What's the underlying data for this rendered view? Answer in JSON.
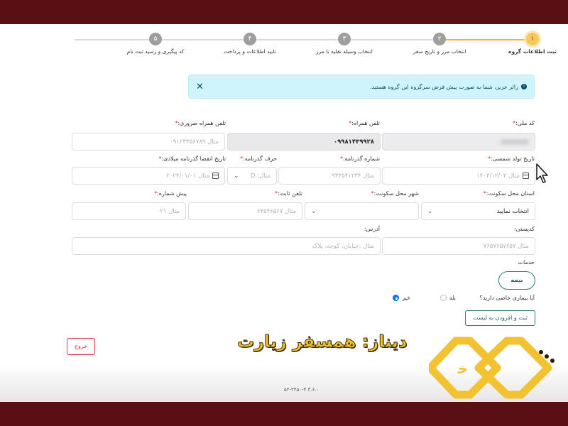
{
  "steps": [
    {
      "num": "۱",
      "label": "ثبت اطلاعات گروه",
      "active": true
    },
    {
      "num": "۲",
      "label": "انتخاب مرز و تاریخ سفر"
    },
    {
      "num": "۳",
      "label": "انتخاب وسیله نقلیه تا مرز"
    },
    {
      "num": "۴",
      "label": "تایید اطلاعات و پرداخت"
    },
    {
      "num": "۵",
      "label": "کد پیگیری و رسید ثبت نام"
    }
  ],
  "alert": {
    "text": "زائر عزیز، شما به صورت پیش فرض سرگروه این گروه هستید.",
    "info": "i",
    "close": "✕"
  },
  "form": {
    "national_code": {
      "label": "کد ملی:",
      "req": "*"
    },
    "mobile": {
      "label": "تلفن همراه:",
      "req": "*",
      "value": "۰۹۹۸۱۴۴۹۹۲۸"
    },
    "emergency_mobile": {
      "label": "تلفن همراه ضروری:",
      "req": "*",
      "placeholder": "مثال ۰۹۱۲۳۴۵۶۷۸۹"
    },
    "birth_date": {
      "label": "تاریخ تولد شمسی:",
      "req": "*",
      "placeholder": "مثال ۱۴۰۳/۱۲/۰۲"
    },
    "passport_no": {
      "label": "شماره گذرنامه:",
      "req": "*",
      "placeholder": "مثال ۹۳۴۵۴۱۲۳۴"
    },
    "passport_letter": {
      "label": "حرف گذرنامه:",
      "req": "*",
      "placeholder": "مثال: D"
    },
    "passport_expiry": {
      "label": "تاریخ انقضا گذرنامه میلادی:",
      "req": "*",
      "placeholder": "مثال ۲۰۲۴/۰۱/۰۱"
    },
    "province": {
      "label": "استان محل سکونت:",
      "req": "*",
      "value": "انتخاب نمایید"
    },
    "city": {
      "label": "شهر محل سکونت:",
      "req": "*"
    },
    "phone": {
      "label": "تلفن ثابت:",
      "req": "*",
      "placeholder": "مثال ۶۴۵۴۶۵۶۷"
    },
    "area_code": {
      "label": "پیش شماره:",
      "req": "*",
      "placeholder": "مثال ۰۲۱"
    },
    "postal_code": {
      "label": "کدپستی:",
      "placeholder": "مثال ۷۶۵۷۶۵۷۶۵۷"
    },
    "address": {
      "label": "آدرس:",
      "placeholder": "مثال :خیابان، کوچه، پلاک"
    }
  },
  "services": {
    "title": "خدمات",
    "insurance": "بیمه"
  },
  "disease": {
    "question": "آیا بیماری خاصی دارید؟",
    "yes": "بله",
    "no": "خیر",
    "selected": "no"
  },
  "add_button": "ثبت و افزودن به لیست",
  "exit_button": "خروج",
  "version": "۵۲-۲۴۵۰-۴.۳.۶.۰",
  "watermark": "دیناز: همسفر زیارت",
  "colors": {
    "frame": "#5a0f14",
    "accent": "#f2b233",
    "alert_bg": "#cff4fc",
    "danger": "#dc3545",
    "logo": "#f2c230"
  }
}
